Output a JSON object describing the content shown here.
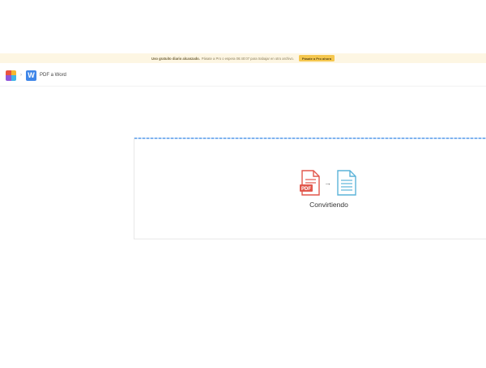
{
  "banner": {
    "bold_text": "Uso gratuito diario alcanzado.",
    "message": "Pásate a Pro o espera 06:40:07 para trabajar en otro archivo.",
    "cta_label": "Pásate a Pro ahora"
  },
  "breadcrumb": {
    "tool_badge": "W",
    "tool_name": "PDF a Word"
  },
  "conversion": {
    "status": "Convirtiendo",
    "source_badge": "PDF"
  },
  "colors": {
    "banner_bg": "#fdf6e3",
    "cta_bg": "#f5c74e",
    "word_blue": "#3f86e8",
    "pdf_red": "#e2574c",
    "doc_blue": "#5bb3d9",
    "progress_blue": "#7fb3ef"
  }
}
